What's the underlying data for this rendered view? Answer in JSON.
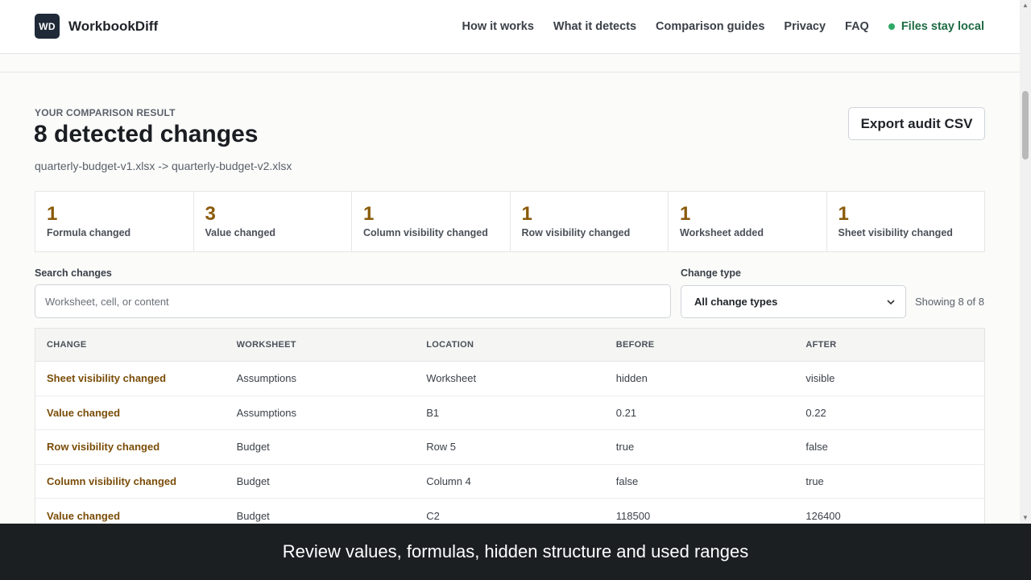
{
  "header": {
    "logo_mark": "WD",
    "brand": "WorkbookDiff",
    "nav": [
      "How it works",
      "What it detects",
      "Comparison guides",
      "Privacy",
      "FAQ"
    ],
    "local_badge": "Files stay local"
  },
  "result": {
    "eyebrow": "YOUR COMPARISON RESULT",
    "title": "8 detected changes",
    "files": "quarterly-budget-v1.xlsx -> quarterly-budget-v2.xlsx",
    "export_label": "Export audit CSV"
  },
  "stats": [
    {
      "count": "1",
      "label": "Formula changed"
    },
    {
      "count": "3",
      "label": "Value changed"
    },
    {
      "count": "1",
      "label": "Column visibility changed"
    },
    {
      "count": "1",
      "label": "Row visibility changed"
    },
    {
      "count": "1",
      "label": "Worksheet added"
    },
    {
      "count": "1",
      "label": "Sheet visibility changed"
    }
  ],
  "filters": {
    "search_label": "Search changes",
    "search_placeholder": "Worksheet, cell, or content",
    "type_label": "Change type",
    "type_selected": "All change types",
    "showing": "Showing 8 of 8"
  },
  "table": {
    "headers": [
      "CHANGE",
      "WORKSHEET",
      "LOCATION",
      "BEFORE",
      "AFTER"
    ],
    "rows": [
      [
        "Sheet visibility changed",
        "Assumptions",
        "Worksheet",
        "hidden",
        "visible"
      ],
      [
        "Value changed",
        "Assumptions",
        "B1",
        "0.21",
        "0.22"
      ],
      [
        "Row visibility changed",
        "Budget",
        "Row 5",
        "true",
        "false"
      ],
      [
        "Column visibility changed",
        "Budget",
        "Column 4",
        "false",
        "true"
      ],
      [
        "Value changed",
        "Budget",
        "C2",
        "118500",
        "126400"
      ]
    ]
  },
  "caption": "Review values, formulas, hidden structure and used ranges",
  "colors": {
    "accent": "#8a5a0a",
    "brand_dark": "#1f2937",
    "local_green": "#2ea865",
    "caption_bg": "#1b1f22"
  }
}
